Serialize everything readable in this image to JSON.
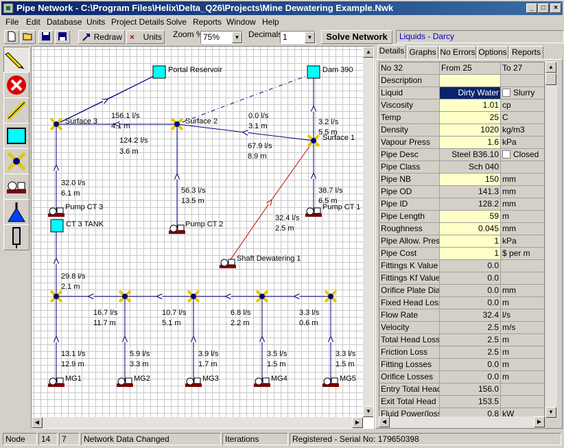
{
  "window": {
    "title": "Pipe Network - C:\\Program Files\\Helix\\Delta_Q26\\Projects\\Mine Dewatering Example.Nwk"
  },
  "menu": [
    "File",
    "Edit",
    "Database",
    "Units",
    "Project Details",
    "Solve",
    "Reports",
    "Window",
    "Help"
  ],
  "toolbar": {
    "redraw": "Redraw",
    "units": "Units",
    "zoom_label": "Zoom %",
    "zoom_value": "75%",
    "decimals_label": "Decimals",
    "decimals_value": "1",
    "solve": "Solve Network",
    "liquid_status": "Liquids - Darcy"
  },
  "network": {
    "nodes": {
      "portal": "Portal Reservoir",
      "dam": "Dam 390",
      "surface3": "Surface 3",
      "surface2": "Surface 2",
      "surface1": "Surface 1",
      "pumpct3": "Pump CT 3",
      "pumpct2": "Pump CT 2",
      "pumpct1": "Pump CT 1",
      "ct3tank": "CT 3 TANK",
      "shaft": "Shaft Dewatering 1",
      "mg1": "MG1",
      "mg2": "MG2",
      "mg3": "MG3",
      "mg4": "MG4",
      "mg5": "MG5"
    },
    "pipes": {
      "p_s2_s3_flow": "156.1 l/s",
      "p_s2_s3_head": "4.1 m",
      "p_s3_down_flow": "124.2 l/s",
      "p_s3_down_head": "3.6 m",
      "p_dam_s2_flow": "0.0 l/s",
      "p_dam_s2_head": "3.1 m",
      "p_dam_s1_flow": "3.2 l/s",
      "p_dam_s1_head": "5.5 m",
      "p_s1_s2_flow": "67.9 l/s",
      "p_s1_s2_head": "8.9 m",
      "p_ct3_flow": "32.0 l/s",
      "p_ct3_head": "6.1 m",
      "p_ct2_flow": "56.3 l/s",
      "p_ct2_head": "13.5 m",
      "p_ct1_flow": "38.7 l/s",
      "p_ct1_head": "6.5 m",
      "p_shaft_flow": "32.4 l/s",
      "p_shaft_head": "2.5 m",
      "p_tank_flow": "29.8 l/s",
      "p_tank_head": "2.1 m",
      "p_j2_flow": "16.7 l/s",
      "p_j2_head": "11.7 m",
      "p_j3_flow": "10.7 l/s",
      "p_j3_head": "5.1 m",
      "p_j4_flow": "6.8 l/s",
      "p_j4_head": "2.2 m",
      "p_j5_flow": "3.3 l/s",
      "p_j5_head": "0.6 m",
      "p_mg1_flow": "13.1 l/s",
      "p_mg1_head": "12.9 m",
      "p_mg2_flow": "5.9 l/s",
      "p_mg2_head": "3.3 m",
      "p_mg3_flow": "3.9 l/s",
      "p_mg3_head": "1.7 m",
      "p_mg4_flow": "3.5 l/s",
      "p_mg4_head": "1.5 m",
      "p_mg5_flow": "3.3 l/s",
      "p_mg5_head": "1.5 m"
    }
  },
  "tabs": [
    "Details",
    "Graphs",
    "No Errors",
    "Options",
    "Reports"
  ],
  "details": {
    "header": [
      "No 32",
      "From 25",
      "To 27"
    ],
    "rows": [
      [
        "Description",
        "",
        ""
      ],
      [
        "Liquid",
        "Dirty Water",
        "Slurry"
      ],
      [
        "Viscosity",
        "1.01",
        "cp"
      ],
      [
        "Temp",
        "25",
        "C"
      ],
      [
        "Density",
        "1020",
        "kg/m3"
      ],
      [
        "Vapour Press",
        "1.6",
        "kPa"
      ],
      [
        "Pipe Desc",
        "Steel B36.10",
        "Closed"
      ],
      [
        "Pipe Class",
        "Sch 040",
        ""
      ],
      [
        "Pipe NB",
        "150",
        "mm"
      ],
      [
        "Pipe OD",
        "141.3",
        "mm"
      ],
      [
        "Pipe ID",
        "128.2",
        "mm"
      ],
      [
        "Pipe Length",
        "59",
        "m"
      ],
      [
        "Roughness",
        "0.045",
        "mm"
      ],
      [
        "Pipe Allow. Press.",
        "1",
        "kPa"
      ],
      [
        "Pipe Cost",
        "1",
        "$ per m"
      ],
      [
        "Fittings K Value",
        "0.0",
        ""
      ],
      [
        "Fittings Kf Value",
        "0.0",
        ""
      ],
      [
        "Orifice Plate Dia",
        "0.0",
        "mm"
      ],
      [
        "Fixed Head Loss",
        "0.0",
        "m"
      ],
      [
        "Flow Rate",
        "32.4",
        "l/s"
      ],
      [
        "Velocity",
        "2.5",
        "m/s"
      ],
      [
        "Total Head Loss",
        "2.5",
        "m"
      ],
      [
        "Friction Loss",
        "2.5",
        "m"
      ],
      [
        "Fitting Losses",
        "0.0",
        "m"
      ],
      [
        "Orifice Losses",
        "0.0",
        "m"
      ],
      [
        "Entry Total Head",
        "156.0",
        ""
      ],
      [
        "Exit Total Head",
        "153.5",
        ""
      ],
      [
        "Fluid Power(losses)",
        "0.8",
        "kW"
      ]
    ]
  },
  "status": {
    "mode": "Node",
    "count1": "14",
    "count2": "7",
    "message": "Network Data Changed",
    "iterations": "Iterations",
    "serial": "Registered - Serial No: 179650398"
  },
  "colors": {
    "title_bar": "#0a246a",
    "reservoir": "#00ffff",
    "pipe": "#000080",
    "selected_pipe": "#ff0000",
    "selected_cell": "#0a246a",
    "input_cell": "#ffffc8"
  }
}
